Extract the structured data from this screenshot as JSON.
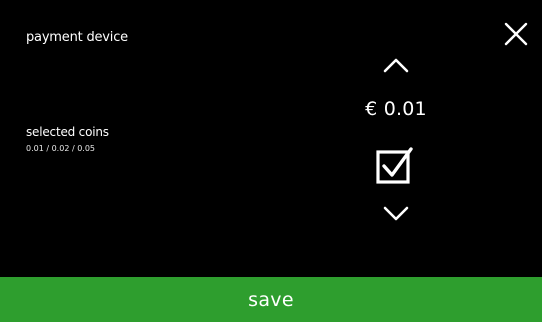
{
  "header": {
    "title": "payment device",
    "close_icon": "close-icon"
  },
  "coins": {
    "label": "selected coins",
    "values": "0.01 / 0.02 / 0.05"
  },
  "selector": {
    "up_icon": "chevron-up-icon",
    "down_icon": "chevron-down-icon",
    "value": "€ 0.01",
    "checked": true,
    "checkbox_icon": "checkbox-checked-icon"
  },
  "footer": {
    "save_label": "save"
  },
  "colors": {
    "background": "#000000",
    "text": "#ffffff",
    "save_bar": "#2e9e2e"
  }
}
